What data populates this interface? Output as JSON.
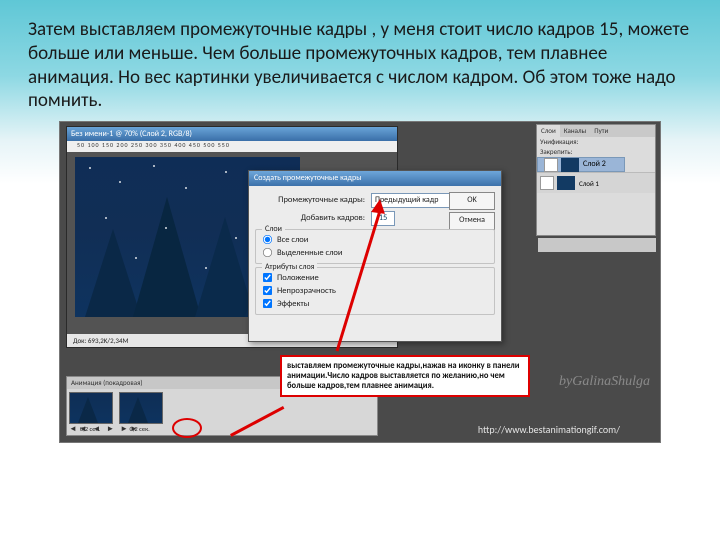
{
  "caption": "Затем выставляем промежуточные кадры , у меня стоит число кадров 15, можете больше или меньше. Чем больше промежуточных кадров, тем плавнее анимация. Но вес картинки увеличивается с числом кадром. Об этом тоже надо помнить.",
  "ps": {
    "title": "Без имени-1 @ 70% (Слой 2, RGB/8)",
    "ruler": "50   100   150   200   250   300   350   400   450   500   550",
    "status": "Док: 693,2K/2,34M"
  },
  "layers": {
    "tabs": [
      "Слои",
      "Каналы",
      "Пути"
    ],
    "lock_label": "Унификация:",
    "opacity_label": "Закрепить:",
    "items": [
      {
        "name": "Слой 2"
      },
      {
        "name": "Слой 1"
      }
    ]
  },
  "dialog": {
    "title": "Создать промежуточные кадры",
    "label_frames": "Промежуточные кадры:",
    "select_value": "Предыдущий кадр",
    "label_add": "Добавить кадров:",
    "add_value": "15",
    "group_layers": "Слои",
    "opt_all": "Все слои",
    "opt_sel": "Выделенные слои",
    "group_attrs": "Атрибуты слоя",
    "opt_pos": "Положение",
    "opt_opac": "Непрозрачность",
    "opt_fx": "Эффекты",
    "ok": "OK",
    "cancel": "Отмена"
  },
  "annotation": "выставляем промежуточные кадры,нажав на иконку в панели анимации.Число кадров выставляется по желанию,но чем больше кадров,тем плавнее анимация.",
  "anim": {
    "tab": "Анимация (покадровая)",
    "frame_labels": [
      "0,2 сек.",
      "0,2 сек."
    ],
    "controls": "◄◄  ◄  ►  ►►"
  },
  "watermark": "byGalinaShulga",
  "source_url": "http://www.bestanimationgif.com/"
}
